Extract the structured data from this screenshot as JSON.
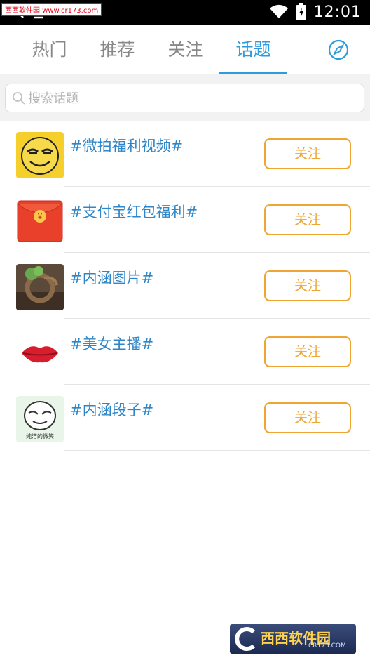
{
  "status_bar": {
    "time": "12:01",
    "watermark": "西西软件园 www.cr173.com"
  },
  "tabs": [
    {
      "label": "热门"
    },
    {
      "label": "推荐"
    },
    {
      "label": "关注"
    },
    {
      "label": "话题",
      "active": true
    }
  ],
  "search": {
    "placeholder": "搜索话题"
  },
  "topics": [
    {
      "title": "#微拍福利视频#",
      "follow_label": "关注",
      "icon": "emoji-face-icon"
    },
    {
      "title": "#支付宝红包福利#",
      "follow_label": "关注",
      "icon": "red-envelope-icon"
    },
    {
      "title": "#内涵图片#",
      "follow_label": "关注",
      "icon": "dragon-tree-icon"
    },
    {
      "title": "#美女主播#",
      "follow_label": "关注",
      "icon": "lips-icon"
    },
    {
      "title": "#内涵段子#",
      "follow_label": "关注",
      "icon": "smirk-face-icon",
      "icon_caption": "纯洁的微笑"
    }
  ],
  "footer_logo": {
    "title": "西西软件园",
    "subtitle": "CR173.COM"
  },
  "colors": {
    "accent": "#2e9bdc",
    "topic_text": "#2e86c8",
    "follow": "#f0a431",
    "inactive_tab": "#888888"
  }
}
